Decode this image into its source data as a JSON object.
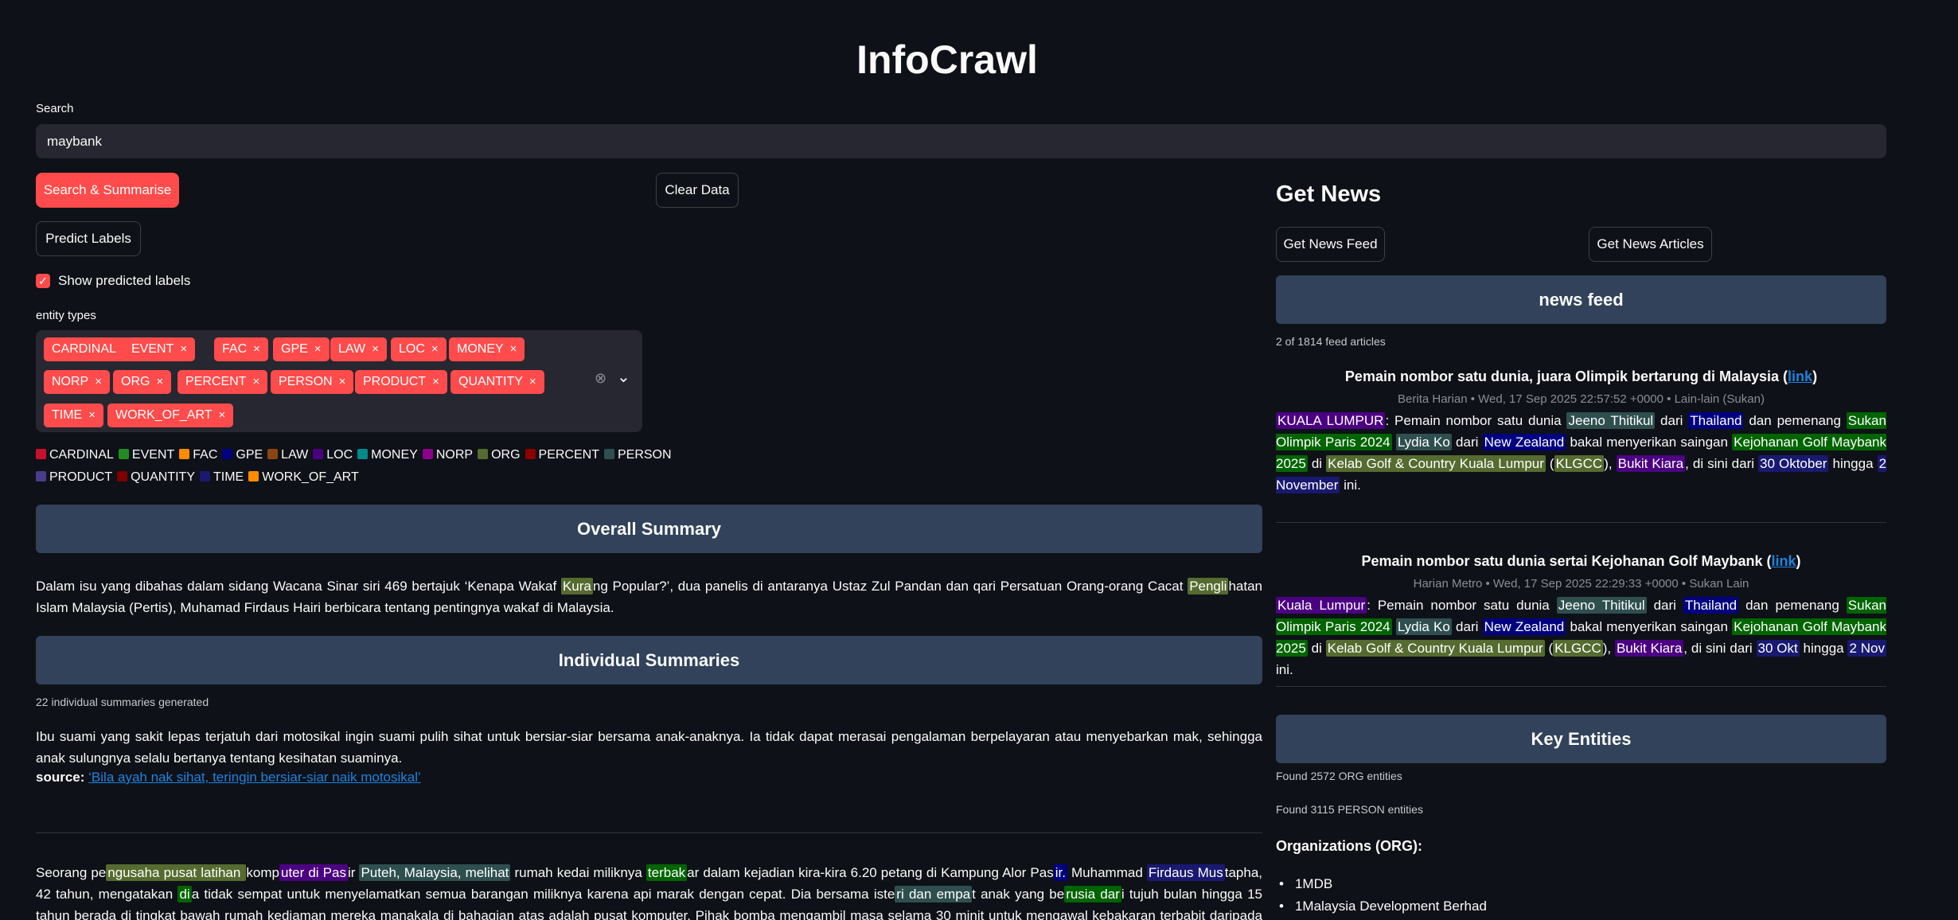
{
  "app": {
    "title": "InfoCrawl"
  },
  "search": {
    "label": "Search",
    "value": "maybank"
  },
  "buttons": {
    "search_summarise": "Search & Summarise",
    "clear_data": "Clear Data",
    "predict_labels": "Predict Labels",
    "get_news_feed": "Get News Feed",
    "get_news_articles": "Get News Articles"
  },
  "show_labels": {
    "label": "Show predicted labels",
    "checked": true,
    "check_glyph": "✓"
  },
  "entity_types": {
    "label": "entity types",
    "selected": [
      "CARDINAL",
      "EVENT",
      "FAC",
      "GPE",
      "LAW",
      "LOC",
      "MONEY",
      "NORP",
      "ORG",
      "PERCENT",
      "PERSON",
      "PRODUCT",
      "QUANTITY",
      "TIME",
      "WORK_OF_ART"
    ],
    "remove_glyph": "×",
    "clear_glyph": "⊗",
    "dropdown_glyph": "⌄"
  },
  "legend": [
    {
      "name": "CARDINAL",
      "color": "#c8102e"
    },
    {
      "name": "EVENT",
      "color": "#228b22"
    },
    {
      "name": "FAC",
      "color": "#ff8c00"
    },
    {
      "name": "GPE",
      "color": "#000080"
    },
    {
      "name": "LAW",
      "color": "#8b4513"
    },
    {
      "name": "LOC",
      "color": "#4b0082"
    },
    {
      "name": "MONEY",
      "color": "#008b8b"
    },
    {
      "name": "NORP",
      "color": "#8b008b"
    },
    {
      "name": "ORG",
      "color": "#556b2f"
    },
    {
      "name": "PERCENT",
      "color": "#8b0000"
    },
    {
      "name": "PERSON",
      "color": "#2f4f4f"
    },
    {
      "name": "PRODUCT",
      "color": "#483d8b"
    },
    {
      "name": "QUANTITY",
      "color": "#800000"
    },
    {
      "name": "TIME",
      "color": "#191970"
    },
    {
      "name": "WORK_OF_ART",
      "color": "#ff8c00"
    }
  ],
  "overall_summary": {
    "header": "Overall Summary",
    "segments": [
      {
        "t": "Dalam isu yang dibahas dalam sidang Wacana Sinar siri 469 bertajuk ‘Kenapa Wakaf "
      },
      {
        "t": "Kura",
        "e": "ORG"
      },
      {
        "t": "ng Popular?’, dua panelis di antaranya Ustaz Zul Pandan dan qari Persatuan Orang-orang Cacat "
      },
      {
        "t": "Pengli",
        "e": "ORG"
      },
      {
        "t": "hatan Islam Malaysia (Pertis), Muhamad Firdaus Hairi berbicara tentang pentingnya wakaf di Malaysia."
      }
    ]
  },
  "individual": {
    "header": "Individual Summaries",
    "count_text": "22 individual summaries generated",
    "summary1": "Ibu suami yang sakit lepas terjatuh dari motosikal ingin suami pulih sihat untuk bersiar-siar bersama anak-anaknya. Ia tidak dapat merasai pengalaman berpelayaran atau menyebarkan mak, sehingga anak sulungnya selalu bertanya tentang kesihatan suaminya.",
    "source_label": "source:",
    "source_link": "‘Bila ayah nak sihat, teringin bersiar-siar naik motosikal’",
    "summary2": [
      {
        "t": "Seorang pe"
      },
      {
        "t": "ngusaha pusat latihan ",
        "e": "ORG"
      },
      {
        "t": "komp"
      },
      {
        "t": "uter di Pas",
        "e": "FAC"
      },
      {
        "t": "ir "
      },
      {
        "t": "Puteh, Malaysia, melihat",
        "e": "PERSON"
      },
      {
        "t": " rumah kedai miliknya "
      },
      {
        "t": "terbak",
        "e": "EVENT"
      },
      {
        "t": "ar dalam kejadian kira-kira 6.20 petang di Kampung Alor Pas"
      },
      {
        "t": "ir.",
        "e": "GPE"
      },
      {
        "t": " Muhammad "
      },
      {
        "t": "Firdaus Mus",
        "e": "DATE"
      },
      {
        "t": "tapha, 42 tahun, mengatakan "
      },
      {
        "t": "di",
        "e": "EVENT"
      },
      {
        "t": "a tidak sempat untuk menyelamatkan semua barangan miliknya karena api marak dengan cepat. Dia bersama iste"
      },
      {
        "t": "ri dan empa",
        "e": "PERSON"
      },
      {
        "t": "t anak yang be"
      },
      {
        "t": "rusia dar",
        "e": "EVENT"
      },
      {
        "t": "i tujuh bulan hingga 15 tahun berada di tingkat bawah rumah kediaman mereka manakala di bahagian atas adalah pusat komputer. Pihak bomba mengambil masa selama 30 minit untuk mengawal kebakaran terbabit daripada merebak dan"
      }
    ]
  },
  "news": {
    "heading": "Get News",
    "feed_header": "news feed",
    "feed_count": "2 of 1814 feed articles",
    "articles": [
      {
        "title": "Pemain nombor satu dunia, juara Olimpik bertarung di Malaysia (",
        "link": "link",
        "title_end": ")",
        "meta": "Berita Harian • Wed, 17 Sep 2025 22:57:52 +0000 • Lain-lain (Sukan)",
        "body": [
          {
            "t": "KUALA LUMPUR",
            "e": "FAC"
          },
          {
            "t": ": Pemain nombor satu dunia "
          },
          {
            "t": "Jeeno Thitikul",
            "e": "PERSON"
          },
          {
            "t": " dari "
          },
          {
            "t": "Thailand",
            "e": "GPE"
          },
          {
            "t": " dan pemenang "
          },
          {
            "t": "Sukan Olimpik Paris 2024",
            "e": "EVENT"
          },
          {
            "t": " "
          },
          {
            "t": "Lydia Ko",
            "e": "PERSON"
          },
          {
            "t": " dari "
          },
          {
            "t": "New Zealand",
            "e": "GPE"
          },
          {
            "t": " bakal menyerikan saingan "
          },
          {
            "t": "Kejohanan Golf Maybank 2025",
            "e": "EVENT"
          },
          {
            "t": " di "
          },
          {
            "t": "Kelab Golf & Country Kuala Lumpur",
            "e": "ORG"
          },
          {
            "t": " ("
          },
          {
            "t": "KLGCC",
            "e": "ORG"
          },
          {
            "t": "), "
          },
          {
            "t": "Bukit Kiara",
            "e": "FAC"
          },
          {
            "t": ", di sini dari "
          },
          {
            "t": "30 Oktober",
            "e": "DATE"
          },
          {
            "t": " hingga "
          },
          {
            "t": "2 November",
            "e": "DATE"
          },
          {
            "t": " ini."
          }
        ]
      },
      {
        "title": "Pemain nombor satu dunia sertai Kejohanan Golf Maybank (",
        "link": "link",
        "title_end": ")",
        "meta": "Harian Metro • Wed, 17 Sep 2025 22:29:33 +0000 • Sukan Lain",
        "body": [
          {
            "t": "Kuala Lumpur",
            "e": "FAC"
          },
          {
            "t": ": Pemain nombor satu dunia "
          },
          {
            "t": "Jeeno Thitikul",
            "e": "PERSON"
          },
          {
            "t": " dari "
          },
          {
            "t": "Thailand",
            "e": "GPE"
          },
          {
            "t": " dan pemenang "
          },
          {
            "t": "Sukan Olimpik Paris 2024",
            "e": "EVENT"
          },
          {
            "t": " "
          },
          {
            "t": "Lydia Ko",
            "e": "PERSON"
          },
          {
            "t": " dari "
          },
          {
            "t": "New Zealand",
            "e": "GPE"
          },
          {
            "t": " bakal menyerikan saingan "
          },
          {
            "t": "Kejohanan Golf Maybank 2025",
            "e": "EVENT"
          },
          {
            "t": " di "
          },
          {
            "t": "Kelab Golf & Country Kuala Lumpur",
            "e": "ORG"
          },
          {
            "t": " ("
          },
          {
            "t": "KLGCC",
            "e": "ORG"
          },
          {
            "t": "), "
          },
          {
            "t": "Bukit Kiara",
            "e": "FAC"
          },
          {
            "t": ", di sini dari "
          },
          {
            "t": "30 Okt",
            "e": "DATE"
          },
          {
            "t": " hingga "
          },
          {
            "t": "2 Nov",
            "e": "DATE"
          },
          {
            "t": " ini."
          }
        ]
      }
    ]
  },
  "key_entities": {
    "header": "Key Entities",
    "org_count": "Found 2572 ORG entities",
    "person_count": "Found 3115 PERSON entities",
    "org_heading": "Organizations (ORG):",
    "orgs": [
      "1MDB",
      "1Malaysia Development Berhad"
    ]
  }
}
